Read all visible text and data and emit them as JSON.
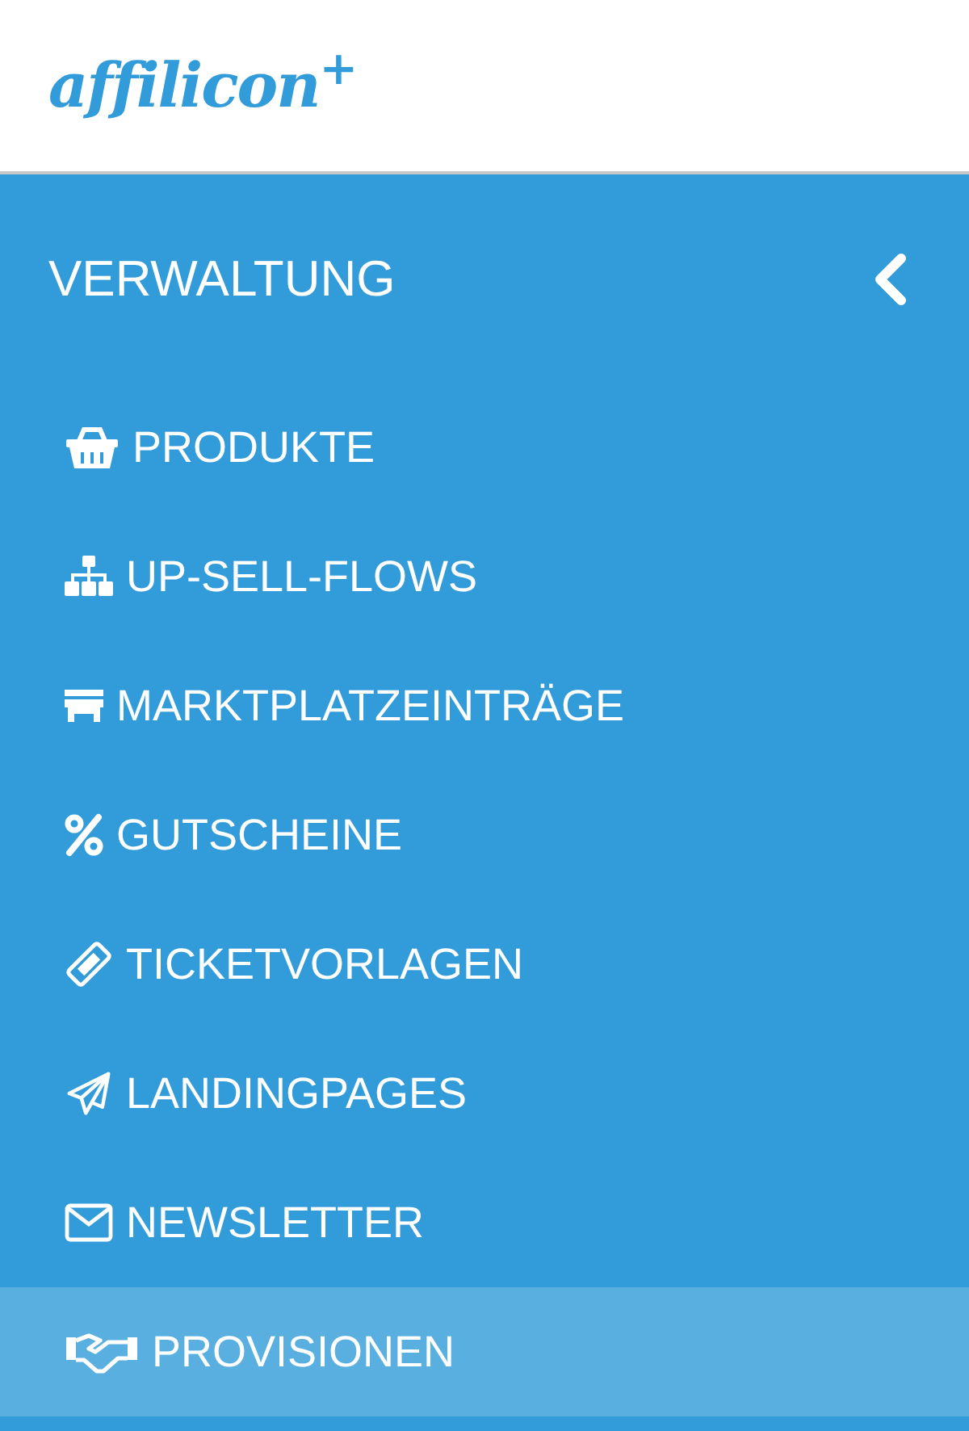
{
  "logo": "affilicon$^{+}$",
  "section": {
    "title": "VERWALTUNG",
    "expanded": true
  },
  "items": [
    {
      "label": "PRODUKTE",
      "selected": false
    },
    {
      "label": "UP-SELL-FLOWS",
      "selected": false
    },
    {
      "label": "MARKTPLATZEINTRÄGE",
      "selected": false
    },
    {
      "label": "GUTSCHEINE",
      "selected": false
    },
    {
      "label": "TICKETVORLAGEN",
      "selected": false
    },
    {
      "label": "LANDINGPAGES",
      "selected": false
    },
    {
      "label": "NEWSLETTER",
      "selected": false
    },
    {
      "label": "PROVISIONEN",
      "selected": true
    }
  ]
}
